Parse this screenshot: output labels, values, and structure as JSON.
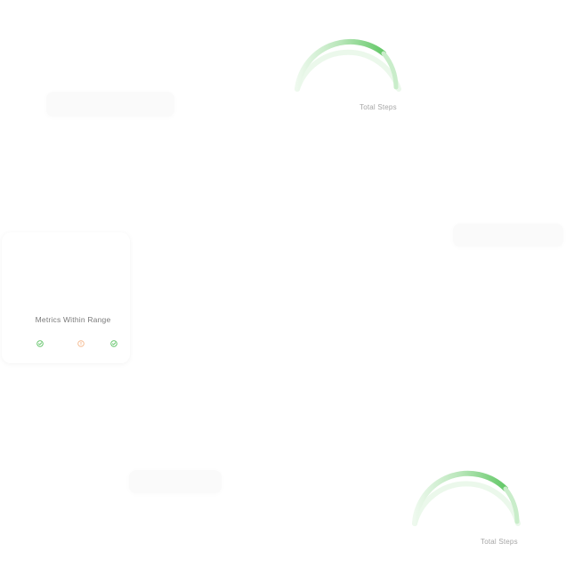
{
  "gauges": [
    {
      "left_label": "",
      "right_label": "Total Steps",
      "progress": 0.8,
      "track_color": "#e8f7e8",
      "fill_start_color": "#e9f8e9",
      "fill_end_color": "#63c867"
    },
    {
      "left_label": "",
      "right_label": "Total Steps",
      "progress": 0.8,
      "track_color": "#e8f7e8",
      "fill_start_color": "#e9f8e9",
      "fill_end_color": "#63c867"
    }
  ],
  "metrics": {
    "title": "Metrics Within Range",
    "icons": [
      {
        "name": "check-circle-icon",
        "color": "#5cc163"
      },
      {
        "name": "warning-circle-icon",
        "color": "#f4b88d"
      },
      {
        "name": "check-circle-icon",
        "color": "#5cc163"
      }
    ]
  }
}
